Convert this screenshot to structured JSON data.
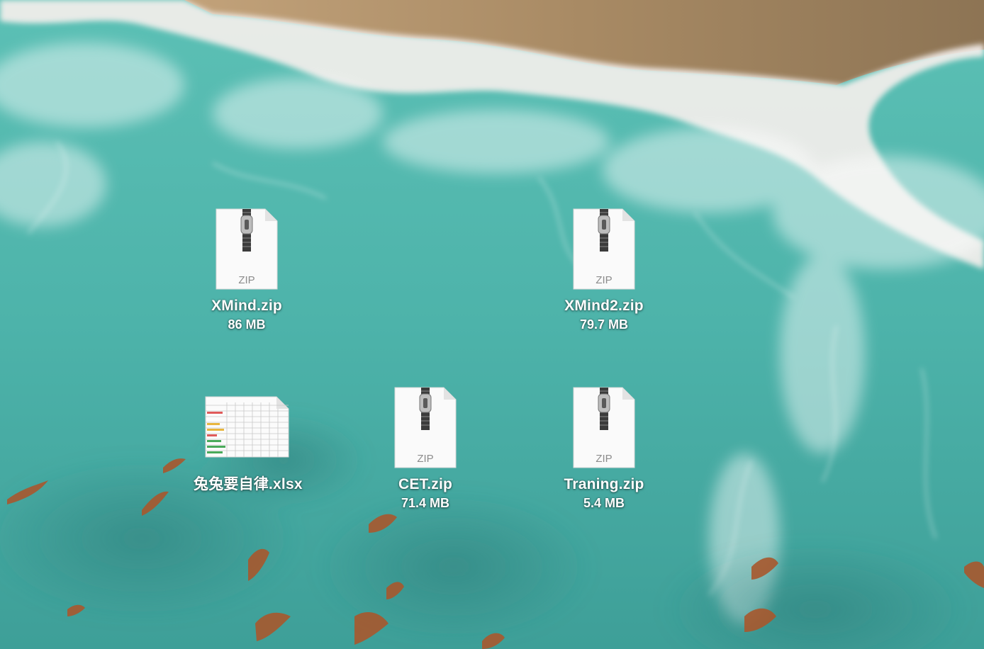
{
  "desktop": {
    "files": [
      {
        "name": "XMind.zip",
        "size": "86 MB",
        "type_label": "ZIP",
        "icon": "zip-archive-icon"
      },
      {
        "name": "XMind2.zip",
        "size": "79.7 MB",
        "type_label": "ZIP",
        "icon": "zip-archive-icon"
      },
      {
        "name": "兔兔要自律.xlsx",
        "size": "",
        "icon": "spreadsheet-icon"
      },
      {
        "name": "CET.zip",
        "size": "71.4 MB",
        "type_label": "ZIP",
        "icon": "zip-archive-icon"
      },
      {
        "name": "Traning.zip",
        "size": "5.4 MB",
        "type_label": "ZIP",
        "icon": "zip-archive-icon"
      }
    ]
  },
  "colors": {
    "sea": "#4fb6ac",
    "sand": "#a98a63",
    "foam": "#f6f2f0",
    "label_text": "#ffffff"
  }
}
